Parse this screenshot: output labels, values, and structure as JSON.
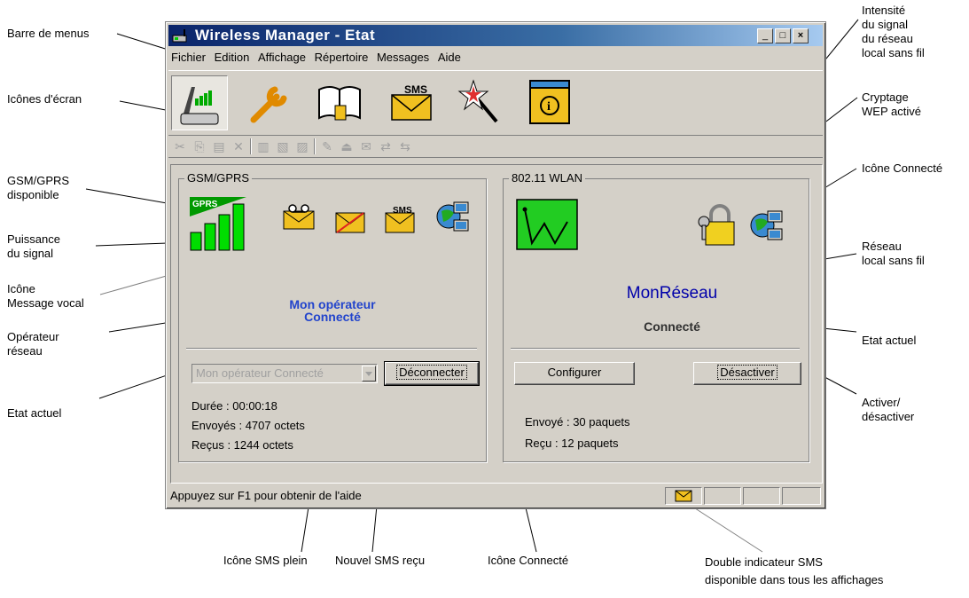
{
  "window": {
    "title": "Wireless Manager - Etat",
    "controls": {
      "minimize": "_",
      "maximize": "□",
      "close": "×"
    }
  },
  "menu": [
    "Fichier",
    "Edition",
    "Affichage",
    "Répertoire",
    "Messages",
    "Aide"
  ],
  "screen_icons": [
    "status-icon",
    "settings-wrench-icon",
    "phonebook-icon",
    "sms-icon",
    "wizard-wand-icon",
    "info-icon"
  ],
  "screen_icon_sms_label": "SMS",
  "toolbar_icons": [
    "cut-icon",
    "copy-icon",
    "paste-icon",
    "delete-icon",
    "book-icon",
    "book-import-icon",
    "book-export-icon",
    "edit-icon",
    "upload-icon",
    "send-icon",
    "transfer-icon",
    "transfer-2-icon"
  ],
  "gsm": {
    "title": "GSM/GPRS",
    "gprs_label": "GPRS",
    "signal_bars": 4,
    "sms_label": "SMS",
    "operator_line1": "Mon opérateur",
    "operator_line2": "Connecté",
    "combo_value": "Mon opérateur Connecté",
    "disconnect_button": "Déconnecter",
    "duration": "Durée : 00:00:18",
    "sent": "Envoyés : 4707 octets",
    "received": "Reçus : 1244 octets"
  },
  "wlan": {
    "title": "802.11 WLAN",
    "network_name": "MonRéseau",
    "state": "Connecté",
    "configure_button": "Configurer",
    "deactivate_button": "Désactiver",
    "sent": "Envoyé : 30 paquets",
    "received": "Reçu : 12 paquets"
  },
  "statusbar": {
    "help_text": "Appuyez sur F1 pour obtenir de l'aide"
  },
  "colors": {
    "title_start": "#0a246a",
    "title_end": "#a6caf0",
    "signal_green": "#00cc00",
    "operator_blue": "#2244cc",
    "network_blue": "#0000aa",
    "envelope": "#f0c020"
  },
  "callouts": {
    "menubar": "Barre de menus",
    "screen_icons": "Icônes d'écran",
    "gsm_available": "GSM/GPRS\ndisponible",
    "signal_strength": "Puissance\ndu signal",
    "voicemail": "Icône\nMessage vocal",
    "operator": "Opérateur\nréseau",
    "gsm_state": "Etat actuel",
    "wlan_signal": "Intensité\ndu signal\ndu réseau\nlocal sans fil",
    "wep": "Cryptage\nWEP activé",
    "wlan_connected": "Icône Connecté",
    "wlan_network": "Réseau\nlocal sans fil",
    "wlan_state": "Etat actuel",
    "toggle": "Activer/\ndésactiver",
    "sms_full": "Icône SMS plein",
    "new_sms": "Nouvel SMS reçu",
    "gsm_connected": "Icône Connecté",
    "dual_sms": "Double indicateur SMS\ndisponible dans tous les affichages"
  }
}
